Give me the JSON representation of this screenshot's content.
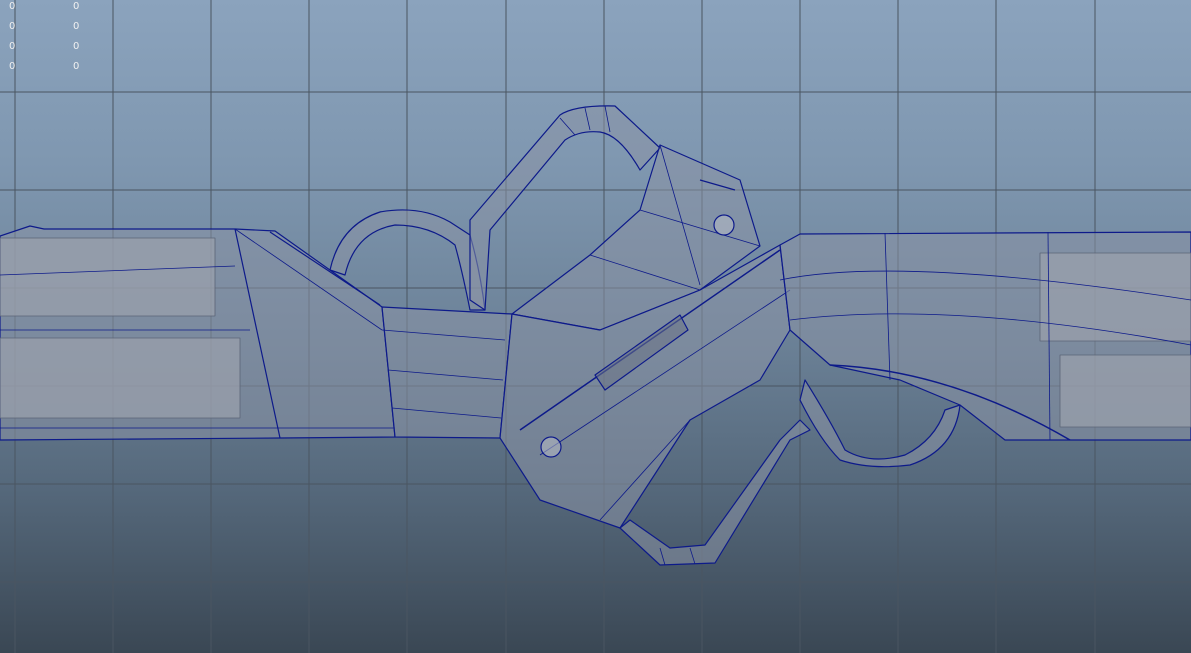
{
  "viewport": {
    "background_top": "#8ba3bd",
    "background_bottom": "#3a4754",
    "grid_color": "#4a5561",
    "wire_color": "#0d1a8a",
    "shade_color": "#8a93a6"
  },
  "heads_up_display": {
    "rows": [
      {
        "a": "0",
        "b": "0"
      },
      {
        "a": "0",
        "b": "0"
      },
      {
        "a": "0",
        "b": "0"
      },
      {
        "a": "0",
        "b": "0"
      }
    ]
  }
}
